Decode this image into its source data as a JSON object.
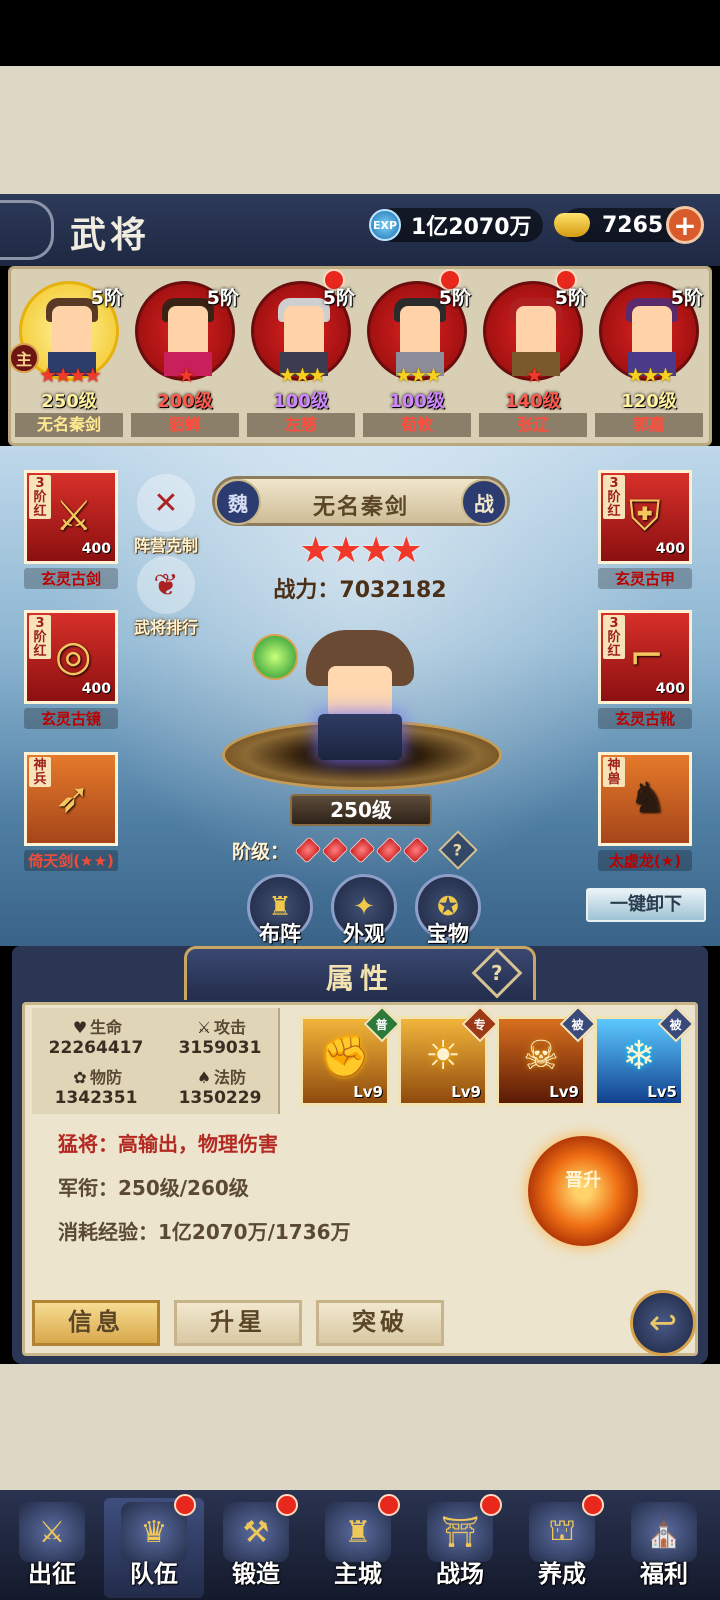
{
  "header": {
    "title": "武将",
    "exp_value": "1亿2070万",
    "exp_icon_label": "EXP",
    "gold_value": "7265",
    "plus_label": "+"
  },
  "heroes": [
    {
      "name": "无名秦剑",
      "rank": "5阶",
      "level": "250级",
      "stars": "★★★★",
      "star_color": "red",
      "selected": true,
      "main_badge": "主"
    },
    {
      "name": "貂蝉",
      "rank": "5阶",
      "level": "200级",
      "stars": "★",
      "star_color": "red"
    },
    {
      "name": "左慈",
      "rank": "5阶",
      "level": "100级",
      "stars": "★★★",
      "star_color": "gold"
    },
    {
      "name": "荀攸",
      "rank": "5阶",
      "level": "100级",
      "stars": "★★★",
      "star_color": "gold"
    },
    {
      "name": "张辽",
      "rank": "5阶",
      "level": "140级",
      "stars": "★",
      "star_color": "red"
    },
    {
      "name": "郭嘉",
      "rank": "5阶",
      "level": "120级",
      "stars": "★★★",
      "star_color": "gold"
    }
  ],
  "equipment": {
    "left": [
      {
        "name": "玄灵古剑",
        "tag": "3阶红",
        "power": "400",
        "icon": "sword-icon"
      },
      {
        "name": "玄灵古镜",
        "tag": "3阶红",
        "power": "400",
        "icon": "mirror-icon"
      },
      {
        "name": "倚天剑(★★)",
        "tag": "神兵",
        "icon": "divine-weapon-icon"
      }
    ],
    "right": [
      {
        "name": "玄灵古甲",
        "tag": "3阶红",
        "power": "400",
        "icon": "armor-icon"
      },
      {
        "name": "玄灵古靴",
        "tag": "3阶红",
        "power": "400",
        "icon": "boots-icon"
      },
      {
        "name": "太虚龙(★)",
        "tag": "神兽",
        "icon": "divine-beast-icon"
      }
    ]
  },
  "side_buttons": {
    "camp": "阵营克制",
    "ranking": "武将排行"
  },
  "hero_detail": {
    "nation": "魏",
    "name": "无名秦剑",
    "type": "战",
    "stars": "★★★★",
    "battle_power_label": "战力：",
    "battle_power": "7032182",
    "level": "250级",
    "grade_label": "阶级：",
    "grade_gems": 5
  },
  "actions": {
    "formation": "布阵",
    "appearance": "外观",
    "treasure": "宝物",
    "unequip_all": "一键卸下"
  },
  "attributes": {
    "title": "属性",
    "help": "?",
    "hp_label": "生命",
    "hp": "22264417",
    "atk_label": "攻击",
    "atk": "3159031",
    "pdef_label": "物防",
    "pdef": "1342351",
    "mdef_label": "法防",
    "mdef": "1350229",
    "skills": [
      {
        "badge": "普",
        "level": "Lv9"
      },
      {
        "badge": "专",
        "level": "Lv9"
      },
      {
        "badge": "被",
        "level": "Lv9"
      },
      {
        "badge": "被",
        "level": "Lv5"
      }
    ],
    "role": "猛将：高输出，物理伤害",
    "rank_label": "军衔：",
    "rank_value": "250级/260级",
    "exp_label": "消耗经验：",
    "exp_value": "1亿2070万/1736万",
    "upgrade_button": "晋升"
  },
  "tabs": [
    "信息",
    "升星",
    "突破"
  ],
  "nav": [
    {
      "label": "出征",
      "icon": "crossed-swords-icon"
    },
    {
      "label": "队伍",
      "icon": "helmet-icon",
      "dot": true
    },
    {
      "label": "锻造",
      "icon": "anvil-icon",
      "dot": true
    },
    {
      "label": "主城",
      "icon": "castle-icon",
      "dot": true
    },
    {
      "label": "战场",
      "icon": "battlefield-icon",
      "dot": true
    },
    {
      "label": "养成",
      "icon": "pagoda-icon",
      "dot": true
    },
    {
      "label": "福利",
      "icon": "gift-palace-icon"
    }
  ]
}
